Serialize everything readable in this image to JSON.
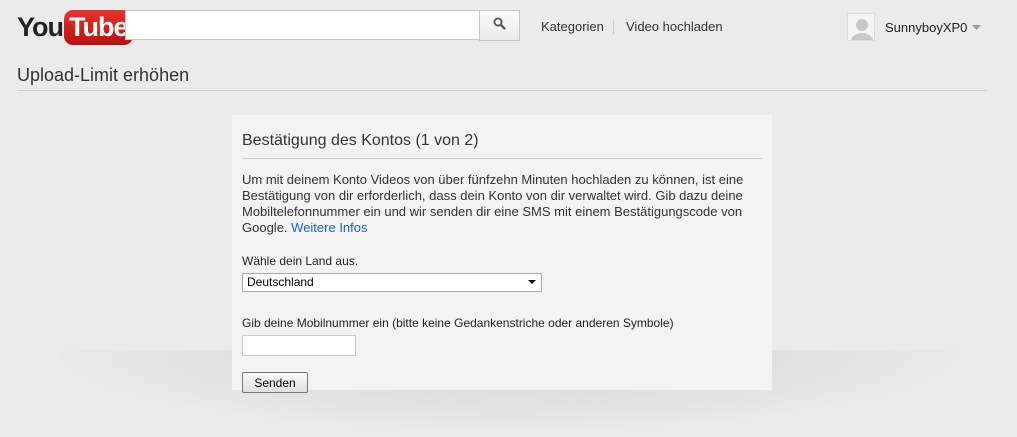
{
  "header": {
    "logo_you": "You",
    "logo_tube": "Tube",
    "search_value": "",
    "search_placeholder": "",
    "nav": {
      "categories": "Kategorien",
      "upload": "Video hochladen"
    },
    "user": {
      "name": "SunnyboyXP0"
    }
  },
  "page": {
    "title": "Upload-Limit erhöhen"
  },
  "card": {
    "title": "Bestätigung des Kontos (1 von 2)",
    "description": "Um mit deinem Konto Videos von über fünfzehn Minuten hochladen zu können, ist eine Bestätigung von dir erforderlich, dass dein Konto von dir verwaltet wird. Gib dazu deine Mobiltelefonnummer ein und wir senden dir eine SMS mit einem Bestätigungscode von Google.",
    "more_link": "Weitere Infos",
    "country_label": "Wähle dein Land aus.",
    "country_selected": "Deutschland",
    "phone_label": "Gib deine Mobilnummer ein (bitte keine Gedankenstriche oder anderen Symbole)",
    "phone_value": "",
    "send_button": "Senden"
  },
  "colors": {
    "background": "#ebebeb",
    "card_background": "#f3f3f3",
    "link": "#1c62b9",
    "logo_red": "#cc181e"
  },
  "icons": {
    "search": "search-icon",
    "avatar": "default-avatar",
    "caret": "caret-down-icon",
    "select_arrow": "select-arrow-icon"
  }
}
